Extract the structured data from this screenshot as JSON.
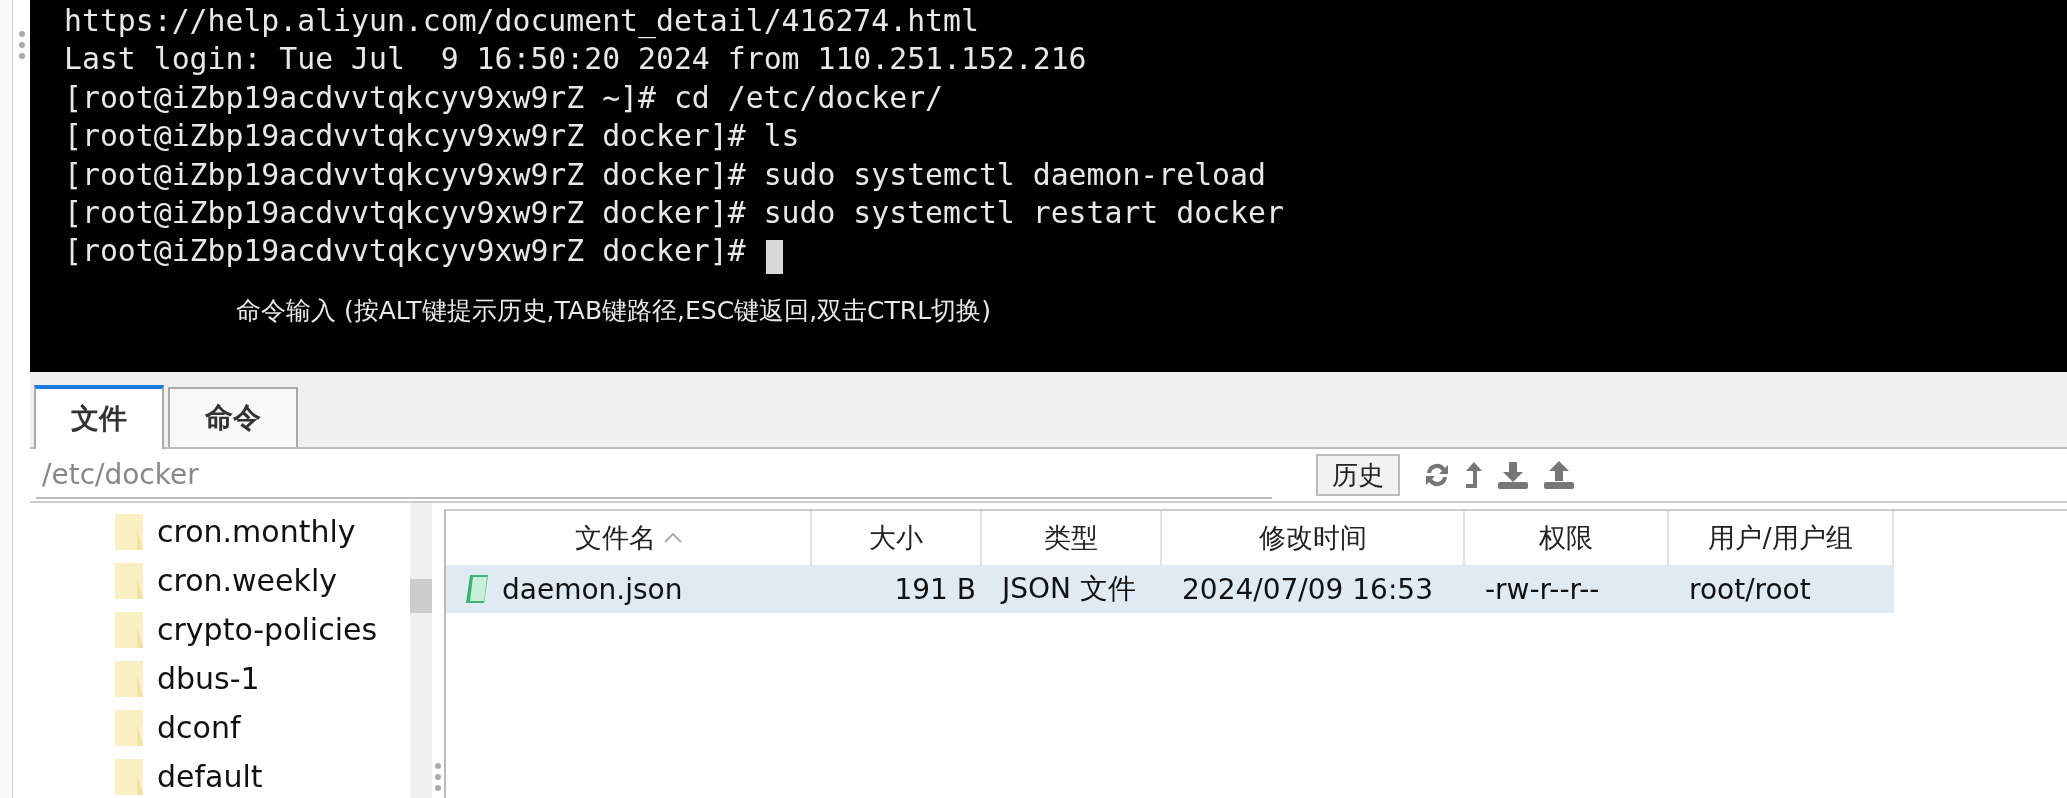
{
  "terminal": {
    "lines": [
      "https://help.aliyun.com/document_detail/416274.html",
      "Last login: Tue Jul  9 16:50:20 2024 from 110.251.152.216",
      "[root@iZbp19acdvvtqkcyv9xw9rZ ~]# cd /etc/docker/",
      "[root@iZbp19acdvvtqkcyv9xw9rZ docker]# ls",
      "[root@iZbp19acdvvtqkcyv9xw9rZ docker]# sudo systemctl daemon-reload",
      "[root@iZbp19acdvvtqkcyv9xw9rZ docker]# sudo systemctl restart docker",
      "[root@iZbp19acdvvtqkcyv9xw9rZ docker]# "
    ],
    "hint": "命令输入 (按ALT键提示历史,TAB键路径,ESC键返回,双击CTRL切换)"
  },
  "tabs": [
    {
      "label": "文件",
      "selected": true
    },
    {
      "label": "命令",
      "selected": false
    }
  ],
  "path_bar": {
    "value": "/etc/docker",
    "history_button": "历史"
  },
  "tree": {
    "items": [
      "cron.monthly",
      "cron.weekly",
      "crypto-policies",
      "dbus-1",
      "dconf",
      "default"
    ]
  },
  "table": {
    "columns": [
      {
        "label": "文件名",
        "sorted": true
      },
      {
        "label": "大小",
        "sorted": false
      },
      {
        "label": "类型",
        "sorted": false
      },
      {
        "label": "修改时间",
        "sorted": false
      },
      {
        "label": "权限",
        "sorted": false
      },
      {
        "label": "用户/用户组",
        "sorted": false
      }
    ],
    "rows": [
      {
        "selected": true,
        "cells": [
          "daemon.json",
          "191 B",
          "JSON 文件",
          "2024/07/09 16:53",
          "-rw-r--r--",
          "root/root"
        ]
      }
    ]
  }
}
